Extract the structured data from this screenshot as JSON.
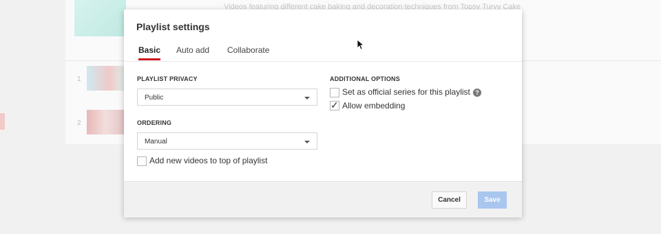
{
  "background": {
    "description_text": "Videos featuring different cake baking and decoration techniques from Topsy Turvy Cake",
    "rows": [
      {
        "number": "1"
      },
      {
        "number": "2"
      }
    ]
  },
  "dialog": {
    "title": "Playlist settings",
    "tabs": [
      {
        "label": "Basic",
        "active": true
      },
      {
        "label": "Auto add",
        "active": false
      },
      {
        "label": "Collaborate",
        "active": false
      }
    ],
    "privacy": {
      "label": "PLAYLIST PRIVACY",
      "value": "Public"
    },
    "ordering": {
      "label": "ORDERING",
      "value": "Manual"
    },
    "add_to_top": {
      "label": "Add new videos to top of playlist",
      "checked": false
    },
    "additional_options": {
      "label": "ADDITIONAL OPTIONS",
      "official_series": {
        "label": "Set as official series for this playlist",
        "checked": false,
        "help_icon": "question-icon"
      },
      "allow_embedding": {
        "label": "Allow embedding",
        "checked": true
      }
    },
    "footer": {
      "cancel_label": "Cancel",
      "save_label": "Save"
    }
  },
  "colors": {
    "accent_tab": "#cc181e",
    "save_button": "#a9c6ef"
  }
}
